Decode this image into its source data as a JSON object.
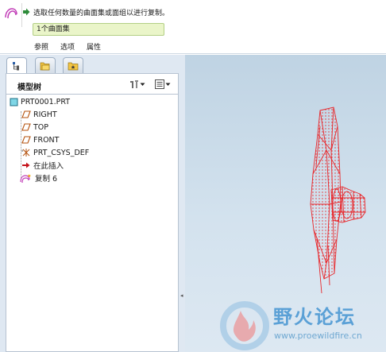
{
  "dashboard": {
    "prompt": "选取任何数量的曲面集或面组以进行复制。",
    "collector_value": "1个曲面集",
    "tabs": [
      {
        "label": "参照"
      },
      {
        "label": "选项"
      },
      {
        "label": "属性"
      }
    ]
  },
  "navigator": {
    "tabs": [
      {
        "icon": "model-tree-icon",
        "active": true
      },
      {
        "icon": "folder-browser-icon",
        "active": false
      },
      {
        "icon": "favorites-icon",
        "active": false
      }
    ],
    "tree_title": "模型树",
    "tree_items": [
      {
        "label": "PRT0001.PRT",
        "icon": "part-icon"
      },
      {
        "label": "RIGHT",
        "icon": "datum-plane-icon"
      },
      {
        "label": "TOP",
        "icon": "datum-plane-icon"
      },
      {
        "label": "FRONT",
        "icon": "datum-plane-icon"
      },
      {
        "label": "PRT_CSYS_DEF",
        "icon": "coordinate-system-icon"
      },
      {
        "label": "在此插入",
        "icon": "insert-here-arrow-icon"
      },
      {
        "label": "复制 6",
        "icon": "copy-feature-icon"
      }
    ]
  },
  "watermark": {
    "title": "野火论坛",
    "url": "www.proewildfire.cn"
  },
  "colors": {
    "model_wireframe": "#e8262a",
    "collector_bg": "#eaf5c9",
    "navigator_bg": "#dfe8f2",
    "watermark_text": "#5aa0d6"
  }
}
